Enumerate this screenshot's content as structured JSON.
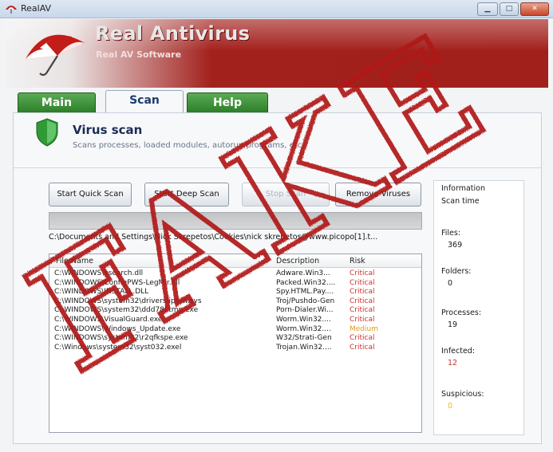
{
  "window": {
    "title": "RealAV",
    "btn_min": "▁",
    "btn_max": "□",
    "btn_close": "✕"
  },
  "header": {
    "title": "Real Antivirus",
    "subtitle": "Real AV Software"
  },
  "tabs": [
    {
      "label": "Main"
    },
    {
      "label": "Scan"
    },
    {
      "label": "Help"
    }
  ],
  "scan": {
    "title": "Virus scan",
    "description": "Scans processes, loaded modules, autorun programs, etc.",
    "buttons": {
      "quick": "Start Quick Scan",
      "deep": "Start Deep Scan",
      "stop": "Stop Scan",
      "remove": "Remove Viruses"
    },
    "progress": 1.0,
    "current_path": "C:\\Documents and Settings\\Nick Skrepetos\\Cookies\\nick skrepetos@www.picopo[1].t...",
    "columns": {
      "file": "File Name",
      "description": "Description",
      "risk": "Risk"
    },
    "results": [
      {
        "file": "C:\\WINDOWS\\xsearch.dll",
        "description": "Adware.Win3...",
        "risk": "Critical"
      },
      {
        "file": "C:\\WINDOWS\\ConfigPWS-LegMir.dll",
        "description": "Packed.Win32....",
        "risk": "Critical"
      },
      {
        "file": "C:\\WINDOWS\\INSTALL.DLL",
        "description": "Spy.HTML.Pay....",
        "risk": "Critical"
      },
      {
        "file": "C:\\WINDOWS\\system32\\drivers\\ip6fw.sys",
        "description": "Troj/Pushdo-Gen",
        "risk": "Critical"
      },
      {
        "file": "C:\\WINDOWS\\system32\\ddd78f.tmp.exe",
        "description": "Porn-Dialer.Wi...",
        "risk": "Critical"
      },
      {
        "file": "C:\\WINDOWS\\VisualGuard.exe",
        "description": "Worm.Win32....",
        "risk": "Critical"
      },
      {
        "file": "C:\\WINDOWS\\Windows_Update.exe",
        "description": "Worm.Win32....",
        "risk": "Medium"
      },
      {
        "file": "C:\\WINDOWS\\system32\\r2qfkspe.exe",
        "description": "W32/Strati-Gen",
        "risk": "Critical"
      },
      {
        "file": "C:\\Windows\\system32\\syst032.exel",
        "description": "Trojan.Win32....",
        "risk": "Critical"
      }
    ]
  },
  "info": {
    "title": "Information",
    "scan_time_label": "Scan time",
    "files_label": "Files:",
    "files": "369",
    "folders_label": "Folders:",
    "folders": "0",
    "processes_label": "Processes:",
    "processes": "19",
    "infected_label": "Infected:",
    "infected": "12",
    "suspicious_label": "Suspicious:",
    "suspicious": "0"
  },
  "overlay": {
    "text": "FAKE"
  },
  "colors": {
    "critical": "#d0312d",
    "medium": "#e59a1c",
    "header_red": "#a3211d",
    "tab_green": "#3c8f37",
    "overlay_red": "#b1161a"
  }
}
